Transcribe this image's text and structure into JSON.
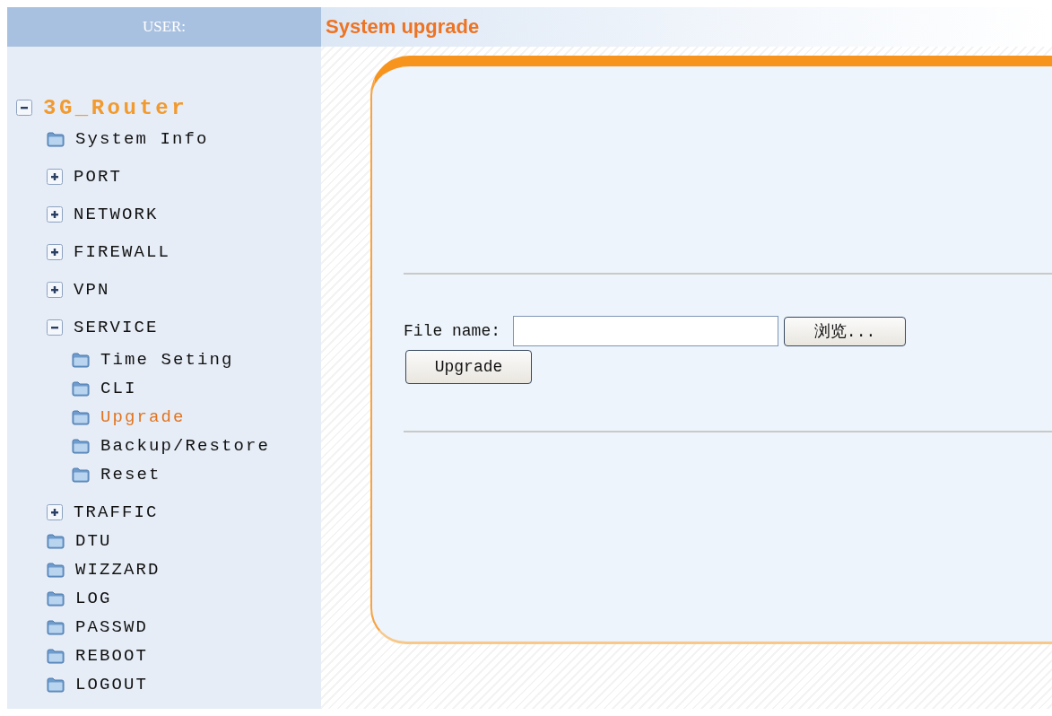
{
  "sidebar": {
    "user_label": "USER:",
    "tree": {
      "label": "3G_Router",
      "kind": "group",
      "expanded": true,
      "children": [
        {
          "label": "System Info",
          "kind": "folder",
          "selected": false
        },
        {
          "label": "PORT",
          "kind": "group",
          "expanded": false
        },
        {
          "label": "NETWORK",
          "kind": "group",
          "expanded": false
        },
        {
          "label": "FIREWALL",
          "kind": "group",
          "expanded": false
        },
        {
          "label": "VPN",
          "kind": "group",
          "expanded": false
        },
        {
          "label": "SERVICE",
          "kind": "group",
          "expanded": true,
          "children": [
            {
              "label": "Time Seting",
              "kind": "folder",
              "selected": false
            },
            {
              "label": "CLI",
              "kind": "folder",
              "selected": false
            },
            {
              "label": "Upgrade",
              "kind": "folder",
              "selected": true
            },
            {
              "label": "Backup/Restore",
              "kind": "folder",
              "selected": false
            },
            {
              "label": "Reset",
              "kind": "folder",
              "selected": false
            }
          ]
        },
        {
          "label": "TRAFFIC",
          "kind": "group",
          "expanded": false
        },
        {
          "label": "DTU",
          "kind": "folder",
          "selected": false
        },
        {
          "label": "WIZZARD",
          "kind": "folder",
          "selected": false
        },
        {
          "label": "LOG",
          "kind": "folder",
          "selected": false
        },
        {
          "label": "PASSWD",
          "kind": "folder",
          "selected": false
        },
        {
          "label": "REBOOT",
          "kind": "folder",
          "selected": false
        },
        {
          "label": "LOGOUT",
          "kind": "folder",
          "selected": false
        }
      ]
    }
  },
  "page_title": "System upgrade",
  "form": {
    "file_label": "File name:",
    "browse_button": "浏览...",
    "upgrade_button": "Upgrade"
  }
}
